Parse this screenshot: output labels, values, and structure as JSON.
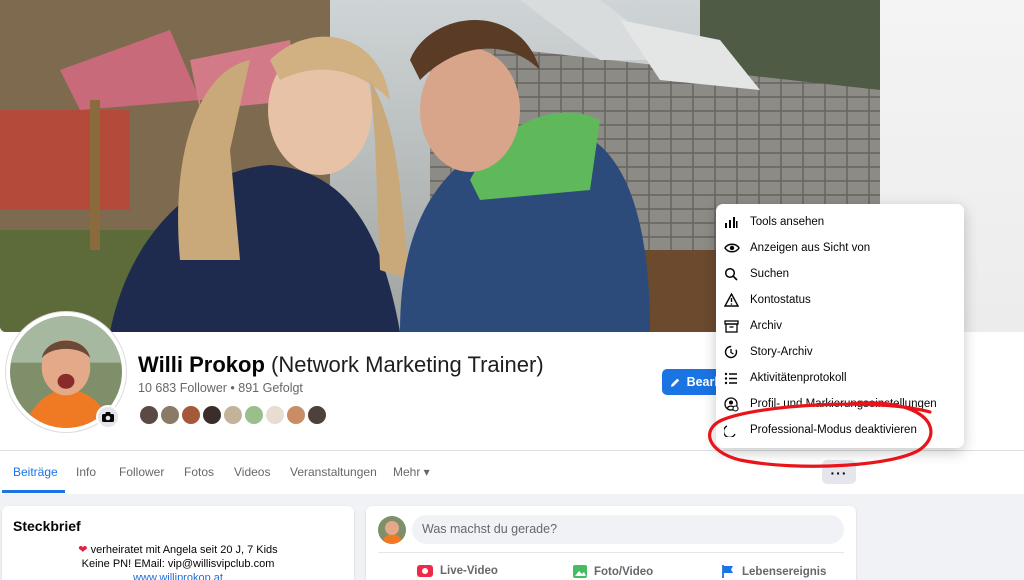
{
  "profile": {
    "name": "Willi Prokop",
    "subtitle": "(Network Marketing Trainer)",
    "stats": "10 683 Follower • 891 Gefolgt",
    "edit_label": "Bearb"
  },
  "tabs": [
    {
      "label": "Beiträge"
    },
    {
      "label": "Info"
    },
    {
      "label": "Follower"
    },
    {
      "label": "Fotos"
    },
    {
      "label": "Videos"
    },
    {
      "label": "Veranstaltungen"
    },
    {
      "label": "Mehr ▾"
    }
  ],
  "more_button": "···",
  "menu": {
    "items": [
      {
        "label": "Tools ansehen",
        "icon": "bar-chart-icon"
      },
      {
        "label": "Anzeigen aus Sicht von",
        "icon": "eye-icon"
      },
      {
        "label": "Suchen",
        "icon": "search-icon"
      },
      {
        "label": "Kontostatus",
        "icon": "warning-icon"
      },
      {
        "label": "Archiv",
        "icon": "archive-icon"
      },
      {
        "label": "Story-Archiv",
        "icon": "history-icon"
      },
      {
        "label": "Aktivitätenprotokoll",
        "icon": "list-icon"
      },
      {
        "label": "Profil- und Markierungseinstellungen",
        "icon": "profile-settings-icon"
      },
      {
        "label": "Professional-Modus deaktivieren",
        "icon": "toggle-off-icon"
      }
    ]
  },
  "intro": {
    "title": "Steckbrief",
    "line1": "verheiratet mit Angela seit 20 J, 7 Kids",
    "line2": "Keine PN! EMail: vip@willisvipclub.com",
    "line3": "www.williprokop.at"
  },
  "composer": {
    "placeholder": "Was machst du gerade?",
    "actions": [
      {
        "label": "Live-Video",
        "color": "#f02849"
      },
      {
        "label": "Foto/Video",
        "color": "#45bd62"
      },
      {
        "label": "Lebensereignis",
        "color": "#1b74e4"
      }
    ]
  },
  "colors": {
    "accent": "#1b74e4",
    "annotation": "#e8141a"
  }
}
